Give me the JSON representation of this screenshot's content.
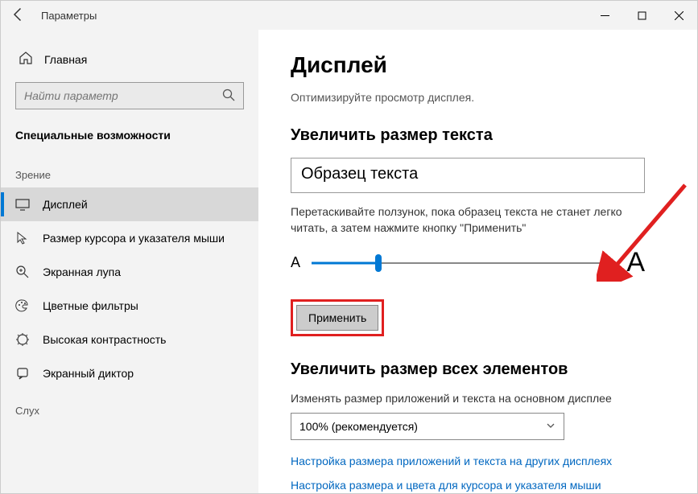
{
  "titlebar": {
    "title": "Параметры"
  },
  "sidebar": {
    "home": "Главная",
    "search_placeholder": "Найти параметр",
    "section_title": "Специальные возможности",
    "group1": "Зрение",
    "items": [
      {
        "label": "Дисплей"
      },
      {
        "label": "Размер курсора и указателя мыши"
      },
      {
        "label": "Экранная лупа"
      },
      {
        "label": "Цветные фильтры"
      },
      {
        "label": "Высокая контрастность"
      },
      {
        "label": "Экранный диктор"
      }
    ],
    "group2": "Слух"
  },
  "content": {
    "heading": "Дисплей",
    "subtitle": "Оптимизируйте просмотр дисплея.",
    "section1_title": "Увеличить размер текста",
    "sample_text": "Образец текста",
    "slider_hint": "Перетаскивайте ползунок, пока образец текста не станет легко читать, а затем нажмите кнопку \"Применить\"",
    "small_a": "A",
    "big_a": "A",
    "apply_label": "Применить",
    "section2_title": "Увеличить размер всех элементов",
    "scale_label": "Изменять размер приложений и текста на основном дисплее",
    "scale_value": "100% (рекомендуется)",
    "link1": "Настройка размера приложений и текста на других дисплеях",
    "link2": "Настройка размера и цвета для курсора и указателя мыши"
  }
}
